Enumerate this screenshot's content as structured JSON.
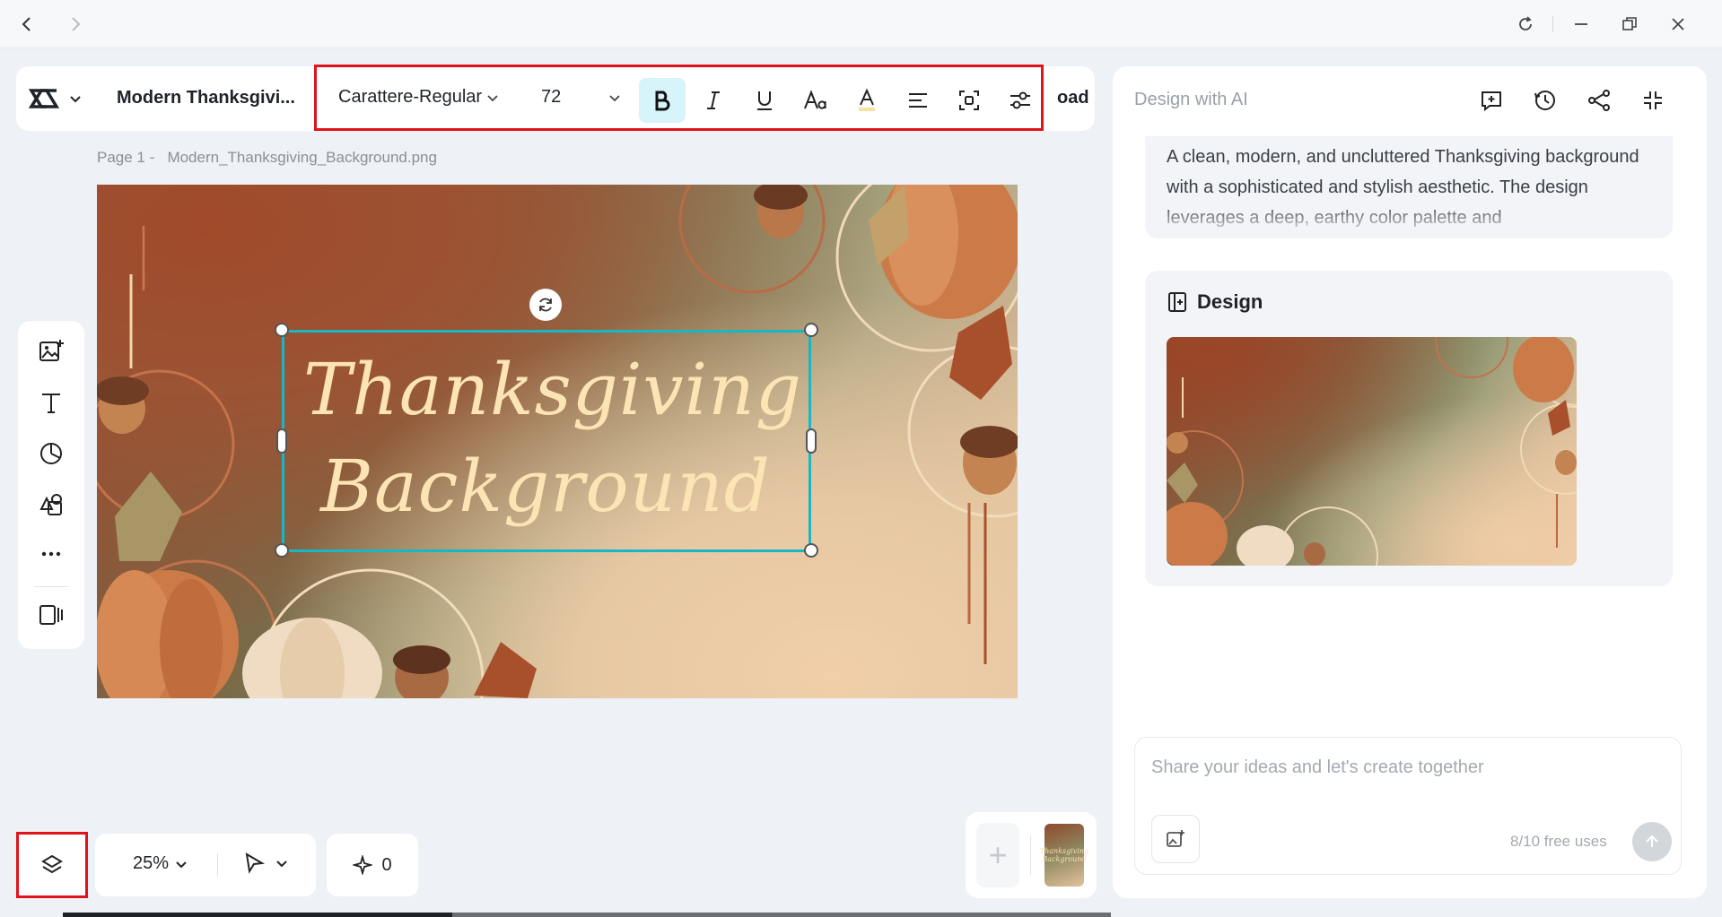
{
  "document": {
    "title": "Modern Thanksgivi...",
    "download_label_partial": "oad",
    "page_label": "Page 1 -",
    "file_name": "Modern_Thanksgiving_Background.png"
  },
  "format_bar": {
    "font_family": "Carattere-Regular",
    "font_size": "72",
    "bold_active": true,
    "icons": [
      "bold-icon",
      "italic-icon",
      "underline-icon",
      "text-case-icon",
      "text-color-icon",
      "align-left-icon",
      "effects-icon",
      "adjust-icon"
    ]
  },
  "canvas": {
    "headline_line1": "Thanksgiving",
    "headline_line2": "Background",
    "palette": {
      "text": "#fde4b4",
      "selection": "#19b6c7",
      "highlight": "#e0121a"
    }
  },
  "left_tools": [
    "image-add-icon",
    "text-icon",
    "shapes-icon",
    "elements-icon",
    "more-icon",
    "pages-panel-icon"
  ],
  "bottom_bar": {
    "zoom": "25%",
    "credits": "0"
  },
  "ai_panel": {
    "title": "Design with AI",
    "description": "A clean, modern, and uncluttered Thanksgiving background with a sophisticated and stylish aesthetic. The design leverages a deep, earthy color palette and",
    "design_heading": "Design",
    "chat_placeholder": "Share your ideas and let's create together",
    "free_uses": "8/10 free uses"
  },
  "page_thumb_text": "Thanksgiving Background"
}
